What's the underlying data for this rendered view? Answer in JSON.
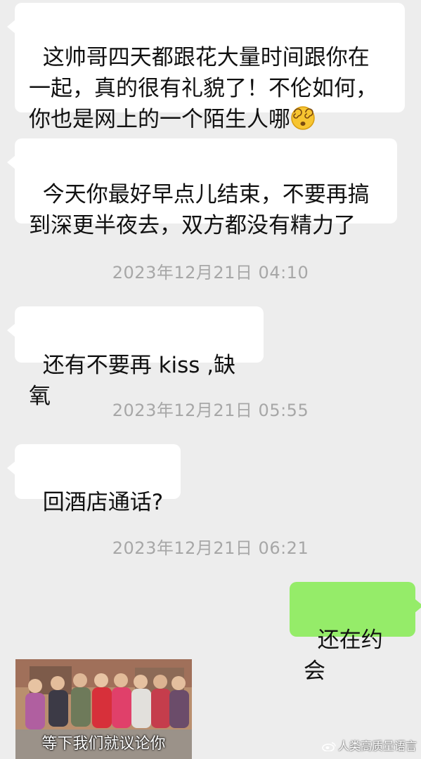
{
  "messages": [
    {
      "text": "这帅哥四天都跟花大量时间跟你在一起，真的很有礼貌了！不伦如何，你也是网上的一个陌生人哪",
      "emoji": "dizzy-face-emoji"
    },
    {
      "text": "今天你最好早点儿结束，不要再搞到深更半夜去，双方都没有精力了"
    },
    {
      "text": "还有不要再 kiss ,缺氧"
    },
    {
      "text": "回酒店通话?"
    },
    {
      "text": "还在约会"
    }
  ],
  "timestamps": [
    "2023年12月21日 04:10",
    "2023年12月21日 05:55",
    "2023年12月21日 06:21"
  ],
  "meme": {
    "caption": "等下我们就议论你"
  },
  "watermark": {
    "text": "人类高质量语言"
  },
  "colors": {
    "background": "#ededed",
    "incoming_bubble": "#ffffff",
    "outgoing_bubble": "#95ec69",
    "timestamp": "#a7a7a7"
  }
}
